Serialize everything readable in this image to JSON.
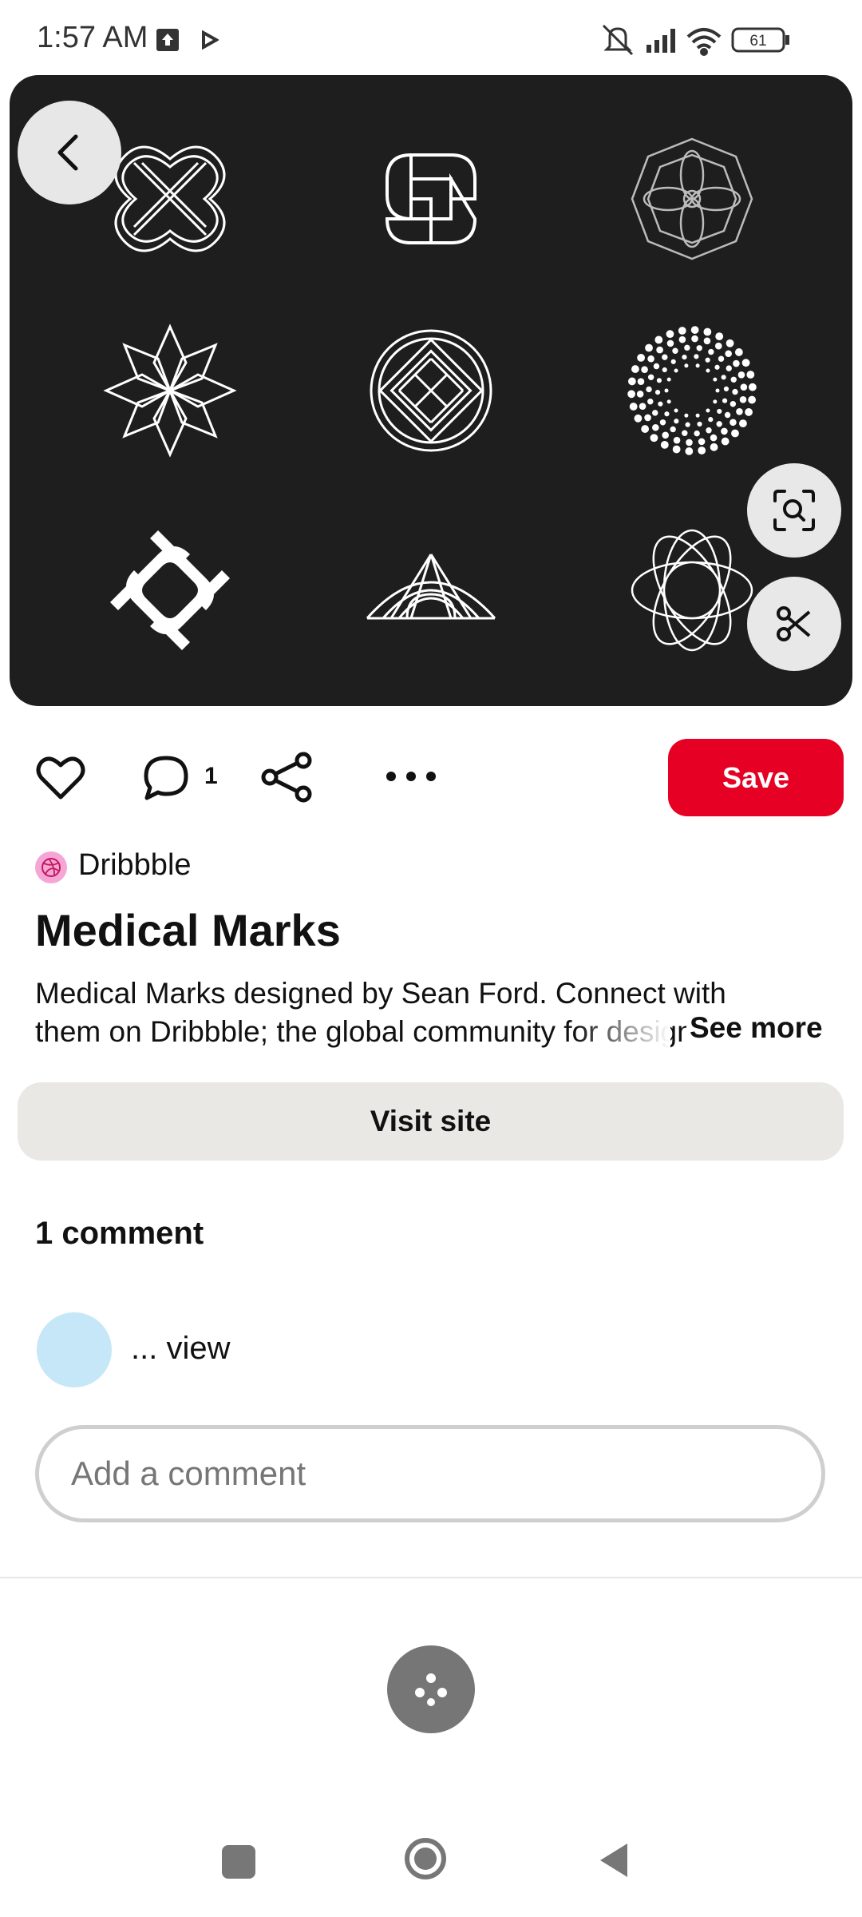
{
  "status_bar": {
    "time": "1:57 AM",
    "battery": "61",
    "icons": [
      "upload-icon",
      "play-icon",
      "mute-icon",
      "signal-icon",
      "wifi-icon",
      "battery-icon"
    ]
  },
  "hero": {
    "background": "#1e1e1e",
    "image_description_icons": [
      "knot-mark-1",
      "knot-mark-2",
      "rosette-mark",
      "star-flower-mark",
      "celtic-knot-mark",
      "dot-spiral-mark",
      "interlock-mark",
      "arch-mark",
      "orbit-mark"
    ]
  },
  "actions": {
    "comment_count": "1",
    "save_label": "Save"
  },
  "pin": {
    "source_name": "Dribbble",
    "title": "Medical Marks",
    "description": "Medical Marks designed by Sean Ford. Connect with them on Dribbble; the global community for designers and creative professionals.",
    "see_more": "See more",
    "visit_site": "Visit site"
  },
  "comments": {
    "heading": "1 comment",
    "items": [
      {
        "text": "... view"
      }
    ],
    "input_placeholder": "Add a comment"
  },
  "colors": {
    "save": "#e60023",
    "visit_bg": "#e9e8e4",
    "avatar_source": "#f5a6d6",
    "avatar_commenter": "#c6e7f7"
  }
}
